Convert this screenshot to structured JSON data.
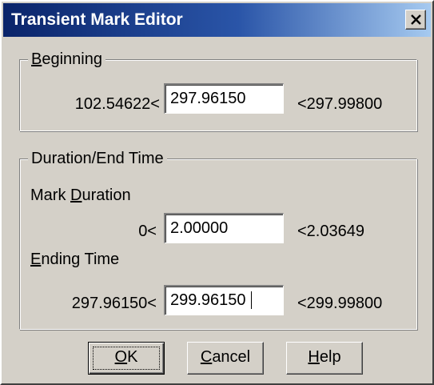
{
  "window": {
    "title": "Transient Mark Editor"
  },
  "beginning": {
    "group_title_mnemonic": "B",
    "group_title_rest": "eginning",
    "min": "102.54622<",
    "value": "297.96150",
    "max": "<297.99800"
  },
  "duration_group": {
    "title": "Duration/End Time",
    "mark_duration": {
      "label_pre": "Mark ",
      "label_mnemonic": "D",
      "label_post": "uration",
      "min": "0<",
      "value": "2.00000",
      "max": "<2.03649"
    },
    "ending_time": {
      "label_mnemonic": "E",
      "label_post": "nding Time",
      "min": "297.96150<",
      "value": "299.96150",
      "max": "<299.99800"
    }
  },
  "buttons": {
    "ok": {
      "mnemonic": "O",
      "rest": "K"
    },
    "cancel": {
      "mnemonic": "C",
      "rest": "ancel"
    },
    "help": {
      "mnemonic": "H",
      "rest": "elp"
    }
  },
  "icons": {
    "close": "close-icon"
  }
}
